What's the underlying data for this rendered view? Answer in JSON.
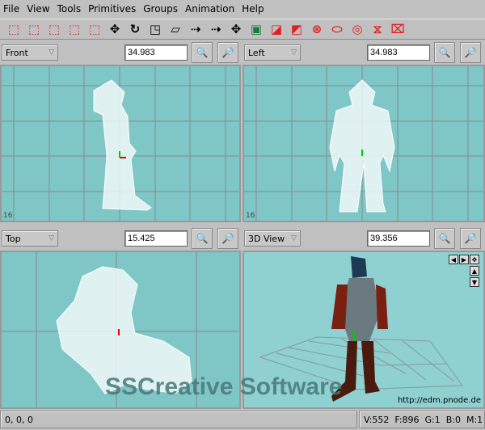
{
  "menu": [
    "File",
    "View",
    "Tools",
    "Primitives",
    "Groups",
    "Animation",
    "Help"
  ],
  "toolbar": [
    "select-vertices-icon",
    "select-faces-icon",
    "select-groups-icon",
    "select-objects-icon",
    "select-bones-icon",
    "move-icon",
    "rotate-icon",
    "scale-icon",
    "shear-icon",
    "flip-icon",
    "extrude-icon",
    "move-view-icon",
    "view-image-icon",
    "create-plane-icon",
    "create-cube-icon",
    "create-sphere-icon",
    "create-cylinder-icon",
    "create-geosphere-icon",
    "create-pyramid-icon",
    "create-bone-icon"
  ],
  "views": [
    {
      "name": "Front",
      "zoom": "34.983",
      "scale": "16"
    },
    {
      "name": "Left",
      "zoom": "34.983",
      "scale": "16"
    },
    {
      "name": "Top",
      "zoom": "15.425"
    },
    {
      "name": "3D View",
      "zoom": "39.356",
      "url": "http://edm.pnode.de"
    }
  ],
  "watermark": "SSCreative Software",
  "status": {
    "coords": "0, 0, 0",
    "stats": "V:552  F:896  G:1  B:0  M:1"
  },
  "colors": {
    "viewport": "#7fc6c6",
    "view3d": "#8fd0d0",
    "grid": "#8a8a8a",
    "accent": "#e02020"
  }
}
